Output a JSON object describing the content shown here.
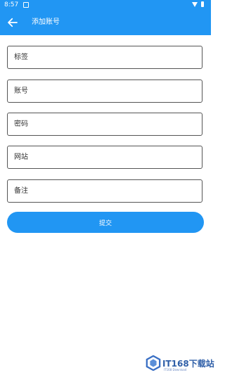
{
  "status_bar": {
    "time": "8:57"
  },
  "app_bar": {
    "title": "添加账号",
    "back_icon": "arrow-left-icon"
  },
  "form": {
    "fields": [
      {
        "placeholder": "标签",
        "value": ""
      },
      {
        "placeholder": "账号",
        "value": ""
      },
      {
        "placeholder": "密码",
        "value": ""
      },
      {
        "placeholder": "网站",
        "value": ""
      },
      {
        "placeholder": "备注",
        "value": ""
      }
    ],
    "submit_label": "提交"
  },
  "watermark": {
    "text": "IT168下载站",
    "subtext": "IT168 Download"
  },
  "colors": {
    "primary": "#2196f3",
    "border": "#555555",
    "background": "#ffffff"
  }
}
